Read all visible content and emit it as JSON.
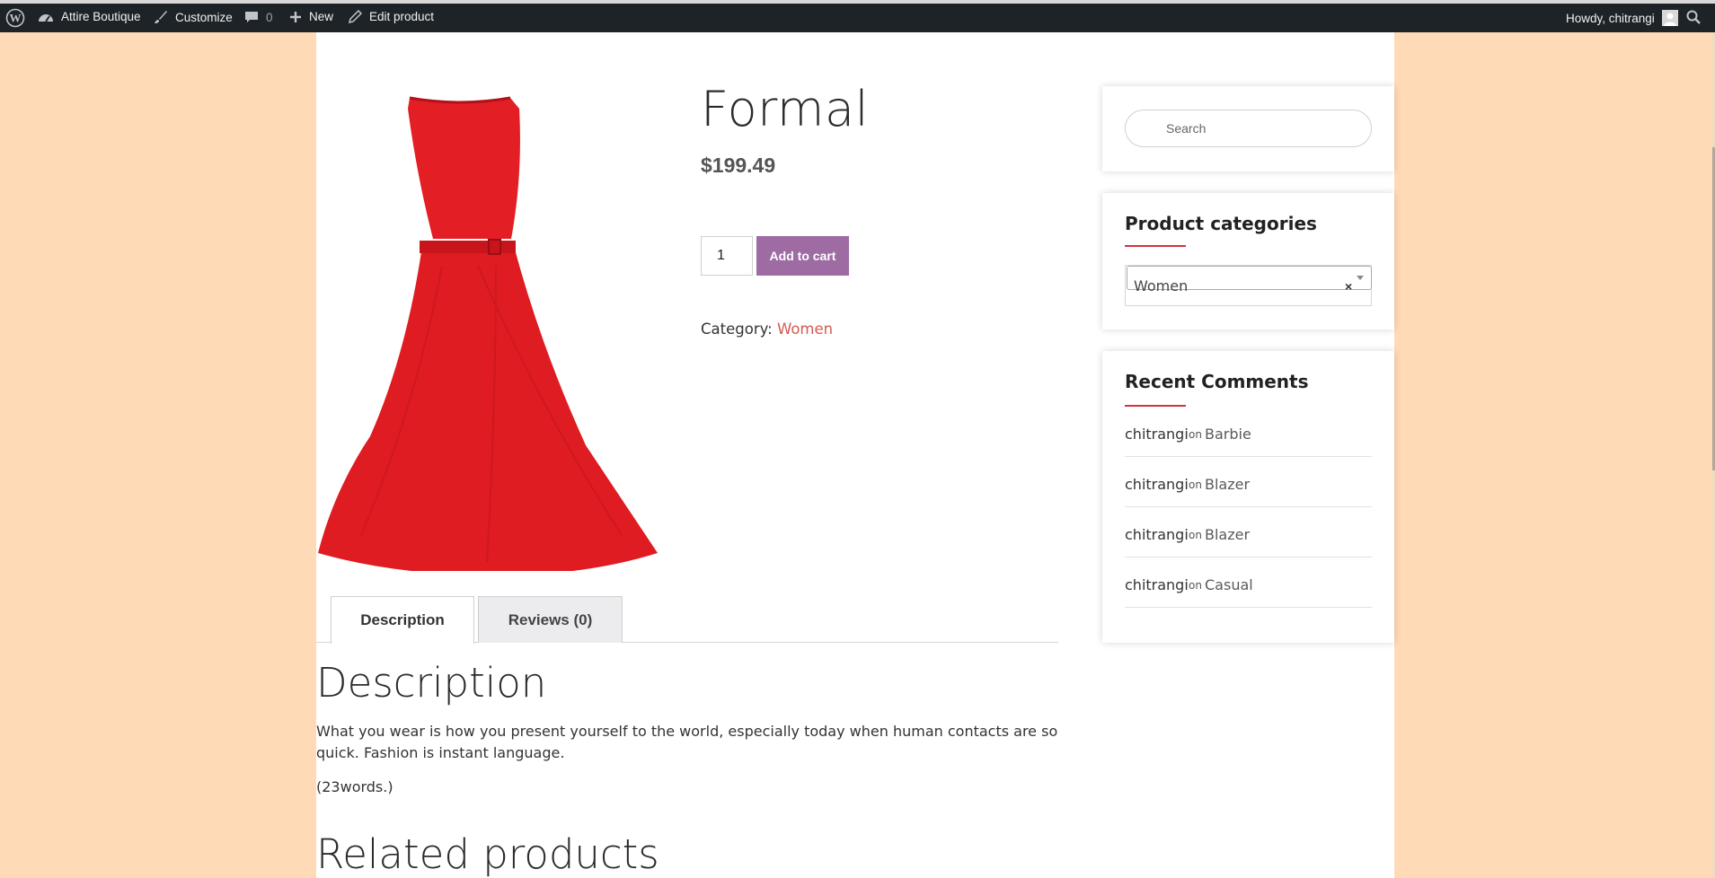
{
  "adminbar": {
    "site_name": "Attire Boutique",
    "customize": "Customize",
    "comments_count": "0",
    "new_label": "New",
    "edit_label": "Edit product",
    "greeting": "Howdy, chitrangi"
  },
  "product": {
    "title": "Formal",
    "price": "$199.49",
    "quantity": "1",
    "add_to_cart": "Add to cart",
    "category_label": "Category:",
    "category": "Women"
  },
  "tabs": [
    {
      "label": "Description",
      "active": true
    },
    {
      "label": "Reviews (0)",
      "active": false
    }
  ],
  "description": {
    "heading": "Description",
    "text": "What you wear is how you present yourself to the world, especially today when human contacts are so quick. Fashion is instant language.",
    "word_count": "(23words.)"
  },
  "related": {
    "heading": "Related products"
  },
  "sidebar": {
    "search_placeholder": "Search",
    "categories_title": "Product categories",
    "selected_category": "Women",
    "comments_title": "Recent Comments",
    "comments": [
      {
        "author": "chitrangi",
        "on": "on",
        "post": "Barbie"
      },
      {
        "author": "chitrangi",
        "on": "on",
        "post": "Blazer"
      },
      {
        "author": "chitrangi",
        "on": "on",
        "post": "Blazer"
      },
      {
        "author": "chitrangi",
        "on": "on",
        "post": "Casual"
      }
    ]
  },
  "colors": {
    "background": "#ffdab6",
    "adminbar": "#1d2327",
    "button": "#9e6ca3",
    "link": "#d35a50",
    "accent": "#d0353a",
    "dress": "#e31e24"
  }
}
